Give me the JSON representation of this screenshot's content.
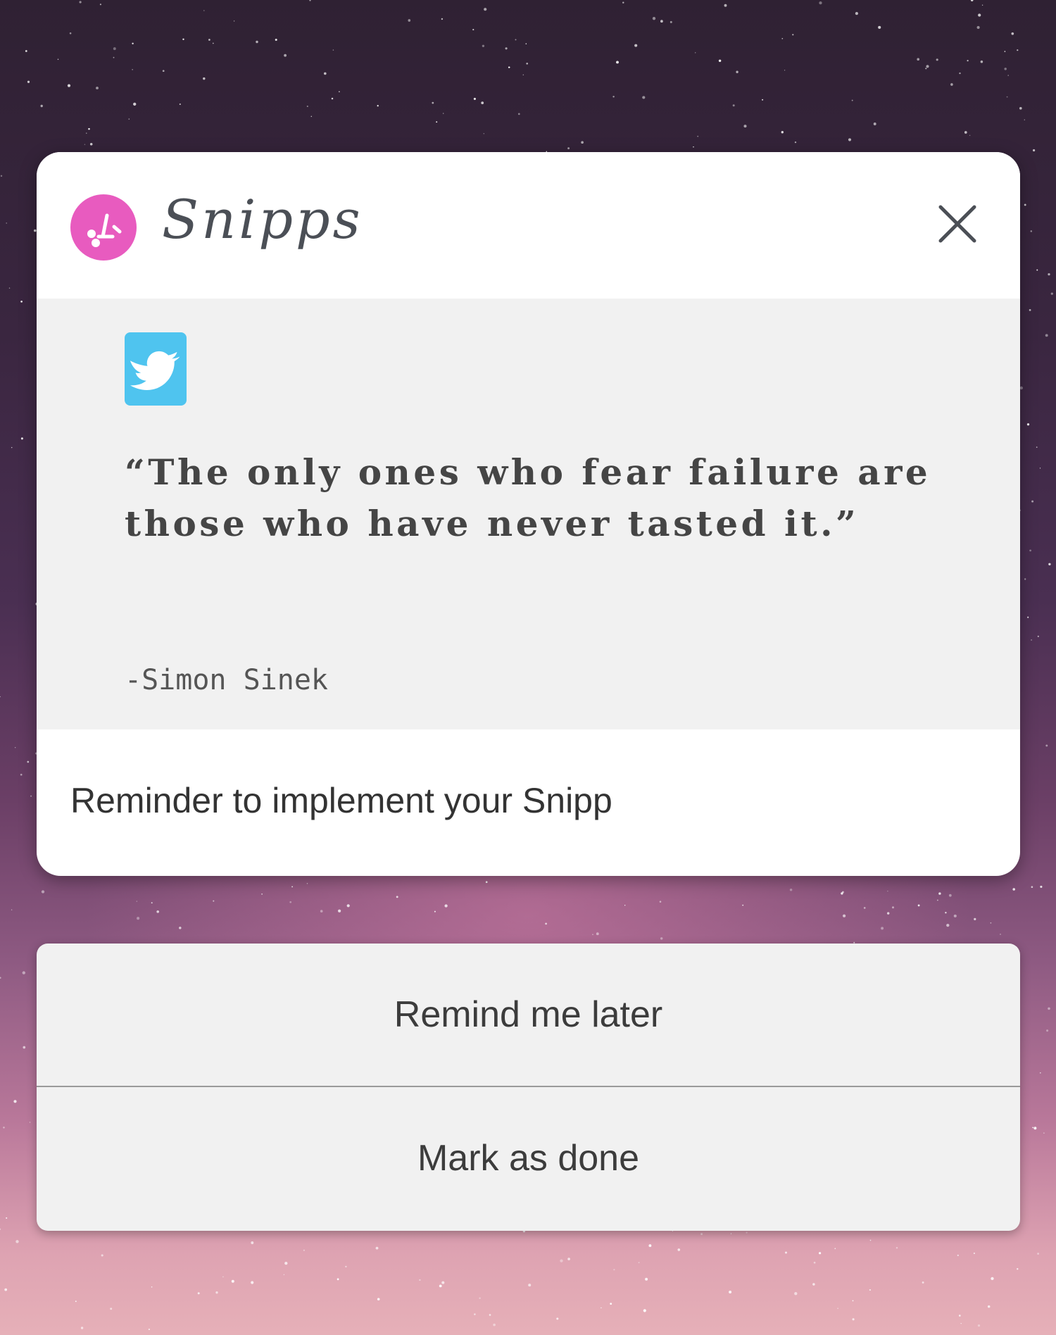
{
  "app": {
    "name": "Snipps",
    "logo_icon": "scissors-icon",
    "brand_color": "#e85bbf"
  },
  "snipp": {
    "source_icon": "twitter-icon",
    "source_color": "#4fc4ef",
    "quote": "“The only ones who fear failure are those who have never tasted it.”",
    "author": "-Simon Sinek"
  },
  "notification": {
    "message": "Reminder to implement your Snipp",
    "close_icon": "close-icon"
  },
  "actions": {
    "remind_later": "Remind me later",
    "mark_done": "Mark as done"
  }
}
